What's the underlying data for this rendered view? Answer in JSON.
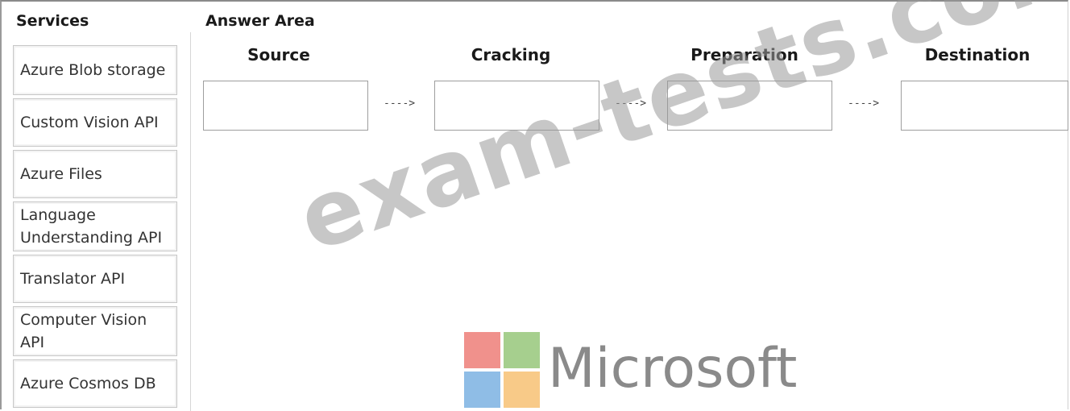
{
  "services": {
    "heading": "Services",
    "items": [
      "Azure Blob storage",
      "Custom Vision API",
      "Azure Files",
      "Language\nUnderstanding API",
      "Translator API",
      "Computer Vision\nAPI",
      "Azure Cosmos DB"
    ]
  },
  "answer_area": {
    "heading": "Answer Area",
    "stages": [
      {
        "label": "Source",
        "value": ""
      },
      {
        "label": "Cracking",
        "value": ""
      },
      {
        "label": "Preparation",
        "value": ""
      },
      {
        "label": "Destination",
        "value": ""
      }
    ],
    "arrow": "---->"
  },
  "watermark": "exam-tests.com",
  "brand": {
    "name": "Microsoft",
    "colors": [
      "#f0918c",
      "#a6cf8e",
      "#8fbde6",
      "#f8ca88"
    ]
  }
}
